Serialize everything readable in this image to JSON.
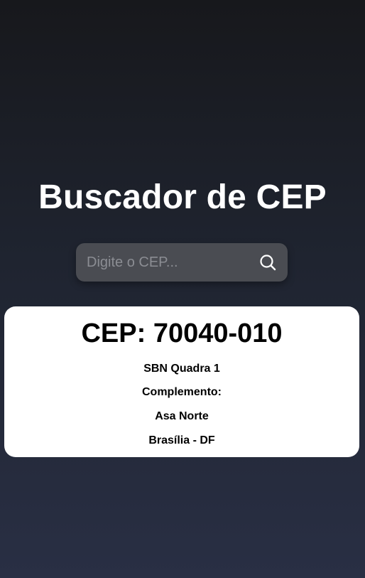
{
  "header": {
    "title": "Buscador de CEP"
  },
  "search": {
    "placeholder": "Digite o CEP...",
    "value": "",
    "button_icon": "search-icon"
  },
  "result": {
    "cep_label": "CEP: ",
    "cep_value": "70040-010",
    "logradouro": "SBN Quadra 1",
    "complemento_label": "Complemento:",
    "complemento_value": "",
    "bairro": "Asa Norte",
    "localidade": "Brasília - DF"
  },
  "colors": {
    "background_top": "#17181c",
    "background_bottom": "#292f44",
    "search_box": "#4a4c52",
    "card": "#ffffff",
    "title_text": "#ffffff"
  }
}
